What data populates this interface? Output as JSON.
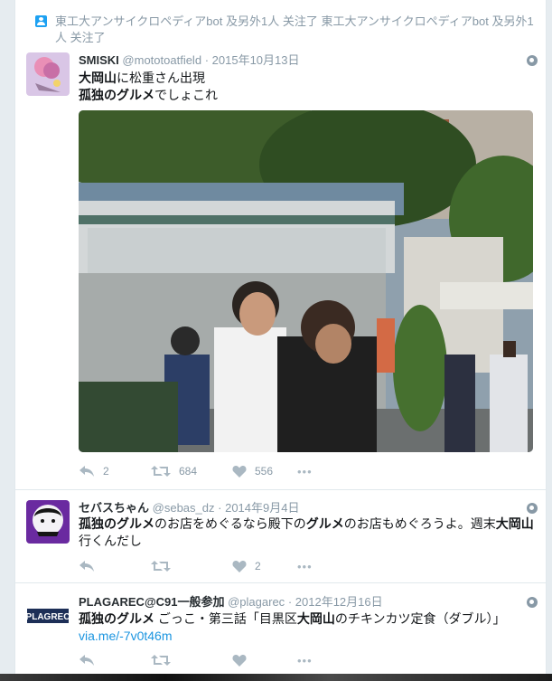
{
  "context": {
    "text": "東工大アンサイクロペディアbot 及另外1人 关注了 東工大アンサイクロペディアbot 及另外1人 关注了"
  },
  "tweets": [
    {
      "fullname": "SMISKI",
      "username": "@mototoatfield",
      "time": "2015年10月13日",
      "line1_bold": "大岡山",
      "line1_rest": "に松重さん出現",
      "line2_bold": "孤独のグルメ",
      "line2_rest": "でしょこれ",
      "reply_count": "2",
      "retweet_count": "684",
      "like_count": "556"
    },
    {
      "fullname": "セバスちゃん",
      "username": "@sebas_dz",
      "time": "2014年9月4日",
      "seg1_bold": "孤独のグルメ",
      "seg2": "のお店をめぐるなら殿下の",
      "seg3_bold": "グルメ",
      "seg4": "のお店もめぐろうよ。週末",
      "seg5_bold": "大岡山",
      "line2": "行くんだし",
      "reply_count": "",
      "retweet_count": "",
      "like_count": "2"
    },
    {
      "fullname": "PLAGAREC@C91一般参加",
      "username": "@plagarec",
      "time": "2012年12月16日",
      "avatar_text": "PLAGREC",
      "seg1_bold": "孤独のグルメ",
      "seg2": " ごっこ・第三話「目黒区",
      "seg3_bold": "大岡山",
      "seg4": "のチキンカツ定食（ダブル）」",
      "link": "via.me/-7v0t46m"
    }
  ],
  "separator": "·",
  "more_label": "•••",
  "colors": {
    "accent": "#1da1f2",
    "link": "#1b95e0",
    "muted": "#8899a6",
    "text": "#14171a"
  }
}
